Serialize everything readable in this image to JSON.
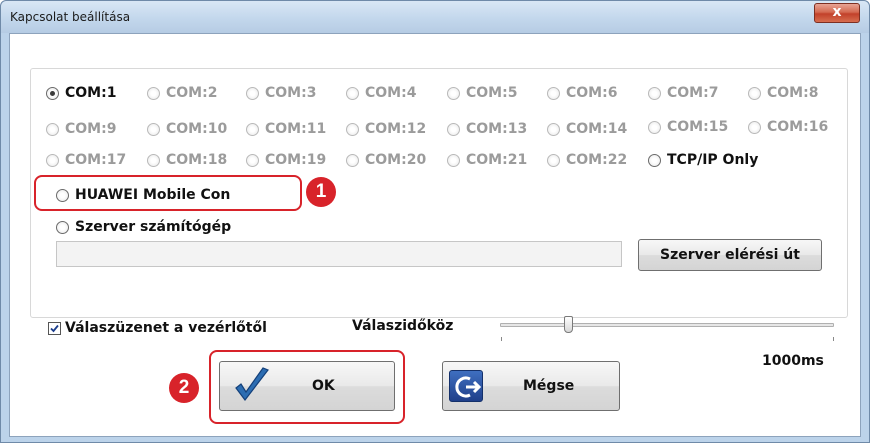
{
  "window": {
    "title": "Kapcsolat beállítása",
    "close_glyph": "x"
  },
  "ports": {
    "row1": [
      "COM:1",
      "COM:2",
      "COM:3",
      "COM:4",
      "COM:5",
      "COM:6",
      "COM:7",
      "COM:8"
    ],
    "row2": [
      "COM:9",
      "COM:10",
      "COM:11",
      "COM:12",
      "COM:13",
      "COM:14",
      "COM:15",
      "COM:16"
    ],
    "row3": [
      "COM:17",
      "COM:18",
      "COM:19",
      "COM:20",
      "COM:21",
      "COM:22",
      "TCP/IP Only"
    ],
    "selected": "COM:1"
  },
  "options": {
    "huawei": "HUAWEI Mobile Con",
    "server": "Szerver számítógép",
    "server_path_value": "",
    "server_path_button": "Szerver elérési út"
  },
  "response": {
    "checkbox_label": "Válaszüzenet a vezérlőtől",
    "checked": true,
    "interval_label": "Válaszidőköz",
    "interval_value": "1000ms"
  },
  "buttons": {
    "ok": "OK",
    "cancel": "Mégse"
  },
  "annotations": {
    "first": "1",
    "second": "2"
  },
  "colors": {
    "annotation": "#d8232a",
    "titlebar": "#c3d7ec",
    "close": "#c2412a"
  },
  "icons": {
    "ok": "checkmark-icon",
    "cancel": "exit-arrow-icon"
  }
}
